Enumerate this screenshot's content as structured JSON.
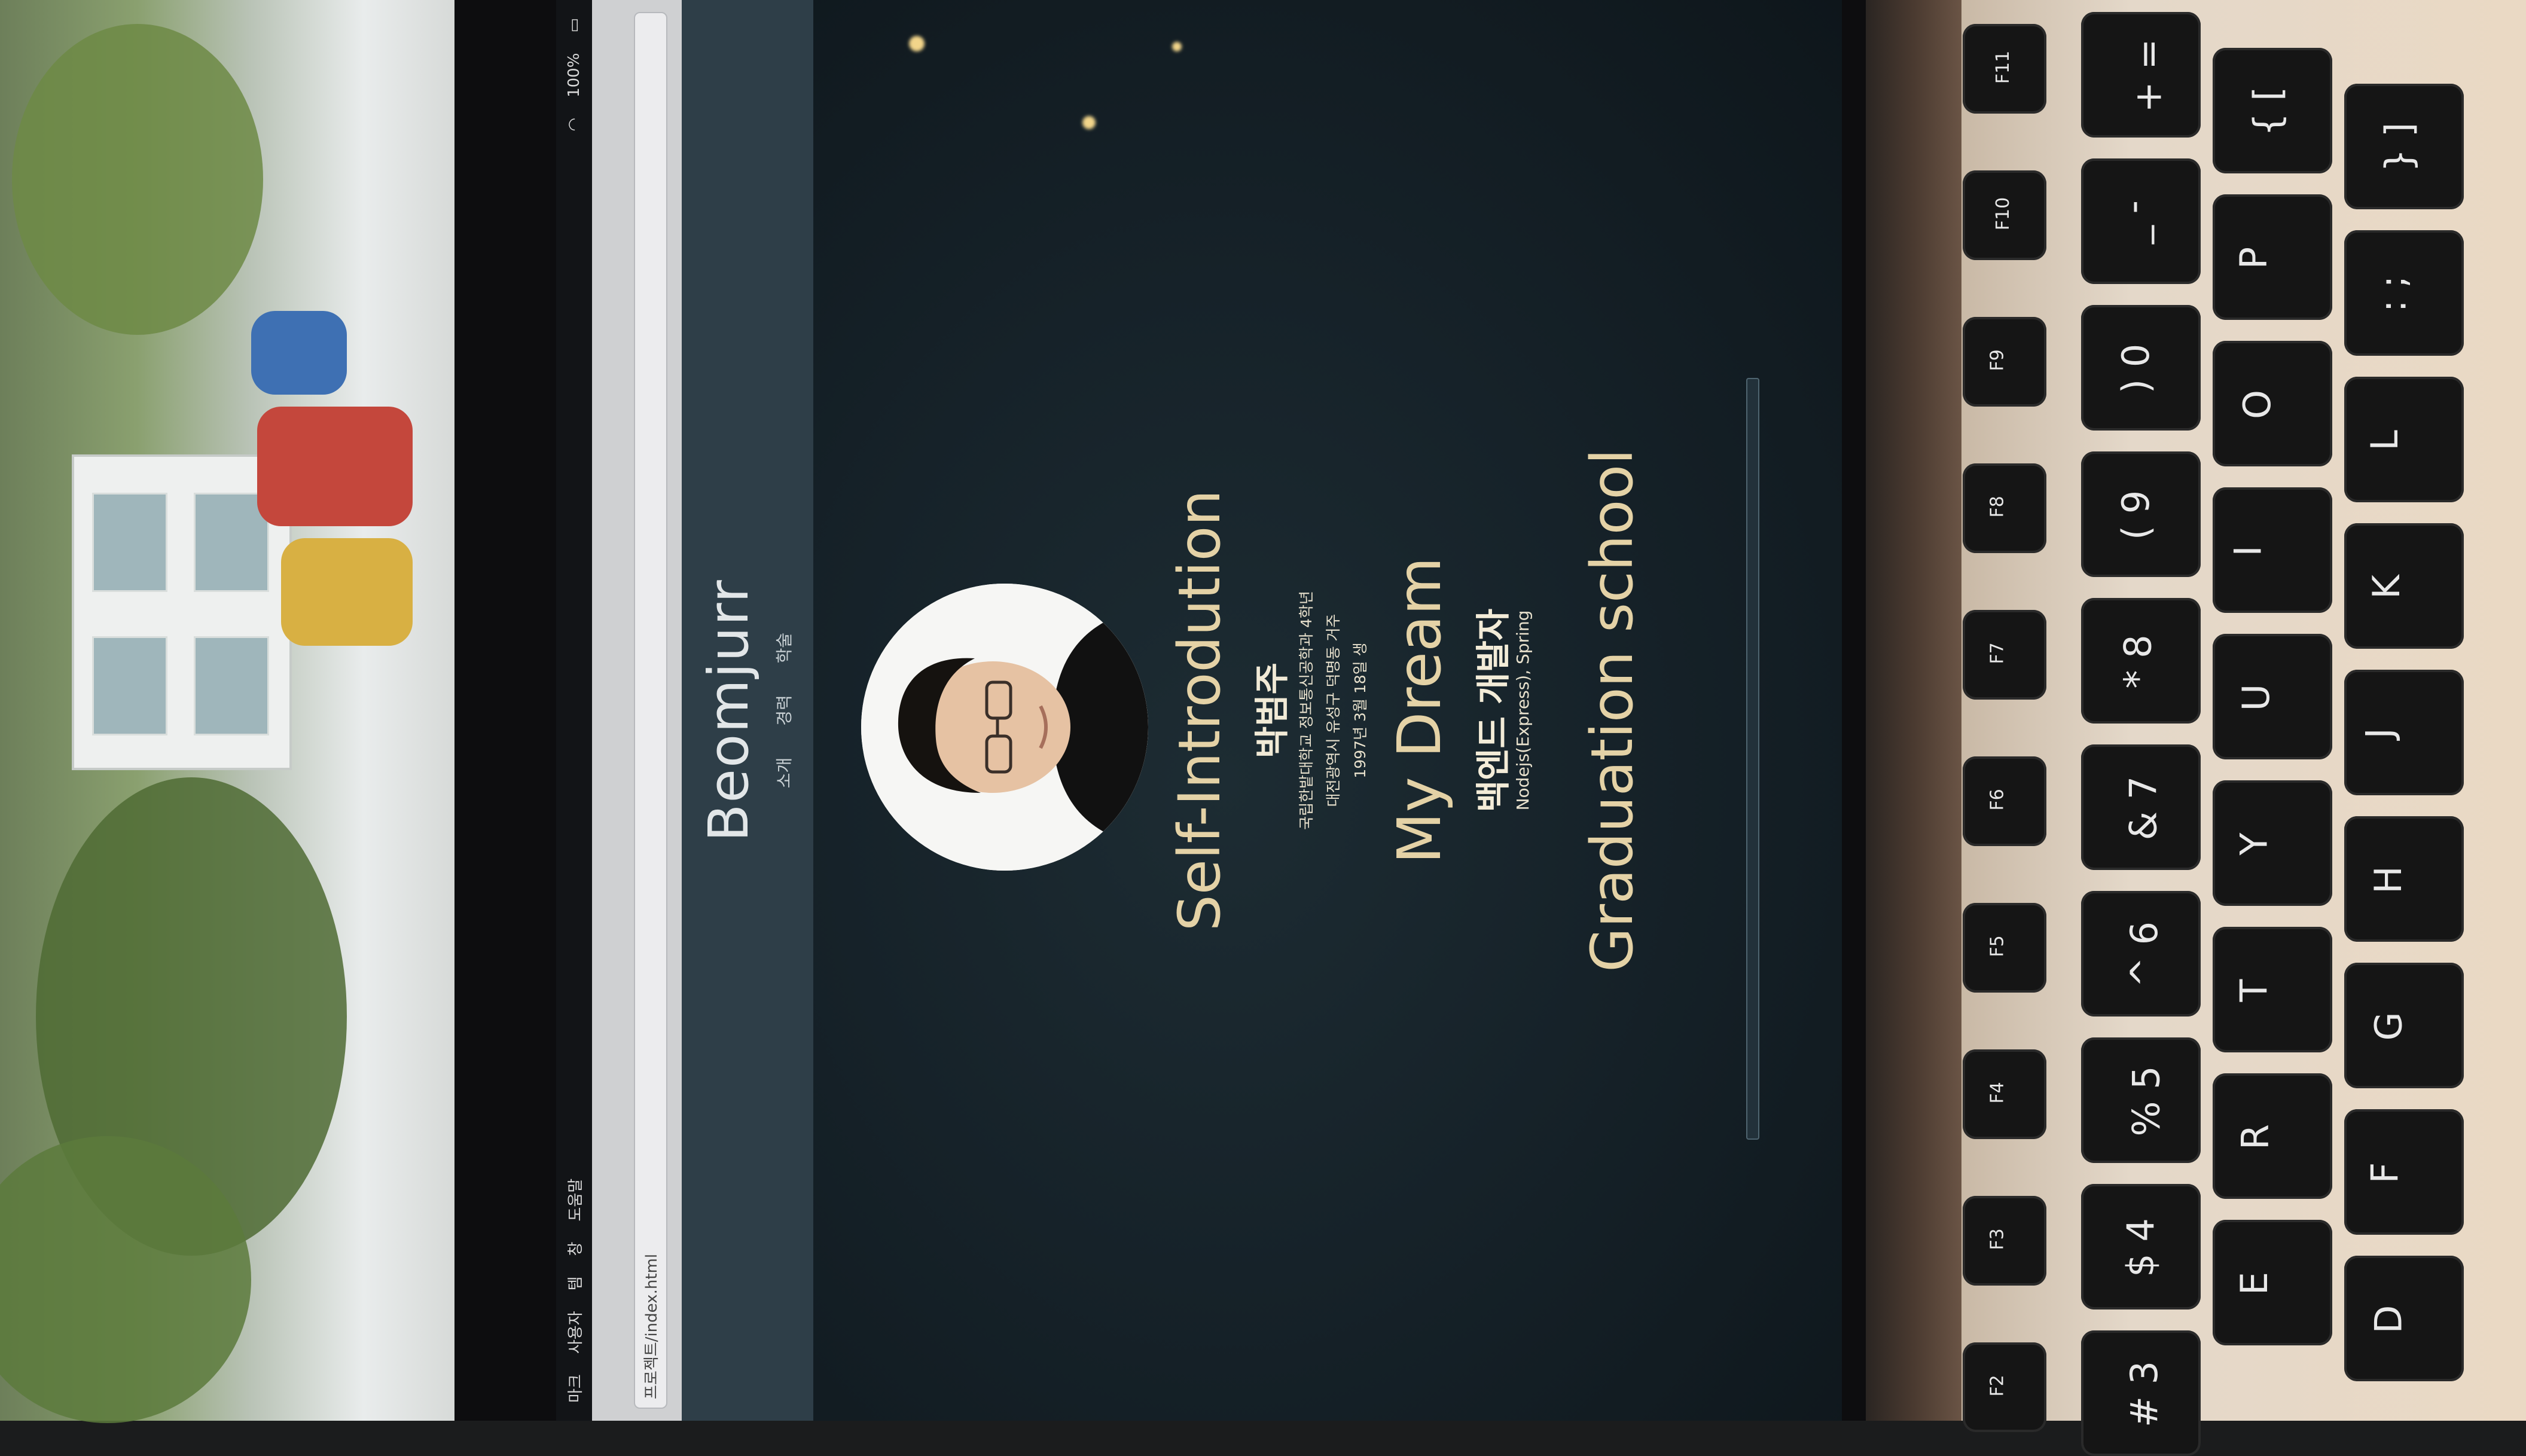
{
  "os": {
    "menu_items": [
      "마크",
      "사용자",
      "템",
      "창",
      "도움말"
    ],
    "status_text": "100%"
  },
  "browser": {
    "url": "프로젝트/index.html"
  },
  "site": {
    "brand": "Beomjurr",
    "nav": [
      "소개",
      "경력",
      "학술"
    ]
  },
  "intro": {
    "heading": "Self-Introdution",
    "name": "박범주",
    "lines": [
      "국립한밭대학교 정보통신공학과 4학년",
      "대전광역시 유성구 덕명동 거주",
      "1997년 3월 18일 생"
    ]
  },
  "dream": {
    "heading": "My Dream",
    "role": "백엔드 개발자",
    "stack": "Nodejs(Express), Spring"
  },
  "graduation": {
    "heading": "Graduation school"
  },
  "keyboard": {
    "keys": [
      {
        "main": "+ =",
        "row": 0
      },
      {
        "main": "{ [",
        "row": 1
      },
      {
        "main": "} ]",
        "row": 2
      },
      {
        "main": "_ -",
        "row": 0
      },
      {
        "main": "P",
        "row": 1
      },
      {
        "main": ": ;",
        "row": 2
      },
      {
        "main": ") 0",
        "row": 0
      },
      {
        "main": "O",
        "row": 1
      },
      {
        "main": "L",
        "row": 2
      },
      {
        "main": "( 9",
        "row": 0
      },
      {
        "main": "I",
        "row": 1
      },
      {
        "main": "K",
        "row": 2
      },
      {
        "main": "* 8",
        "row": 0
      },
      {
        "main": "U",
        "row": 1
      },
      {
        "main": "J",
        "row": 2
      },
      {
        "main": "& 7",
        "row": 0
      },
      {
        "main": "Y",
        "row": 1
      },
      {
        "main": "H",
        "row": 2
      },
      {
        "main": "^ 6",
        "row": 0
      },
      {
        "main": "T",
        "row": 1
      },
      {
        "main": "G",
        "row": 2
      },
      {
        "main": "% 5",
        "row": 0
      },
      {
        "main": "R",
        "row": 1
      },
      {
        "main": "F",
        "row": 2
      },
      {
        "main": "$ 4",
        "row": 0
      },
      {
        "main": "E",
        "row": 1
      },
      {
        "main": "D",
        "row": 2
      },
      {
        "main": "# 3",
        "row": 0
      }
    ],
    "fn_keys": [
      "F11",
      "F10",
      "F9",
      "F8",
      "F7",
      "F6",
      "F5",
      "F4",
      "F3",
      "F2"
    ]
  },
  "colors": {
    "header_bg": "#2e3e48",
    "page_bg": "#162229",
    "gold": "#e4d2a6"
  }
}
